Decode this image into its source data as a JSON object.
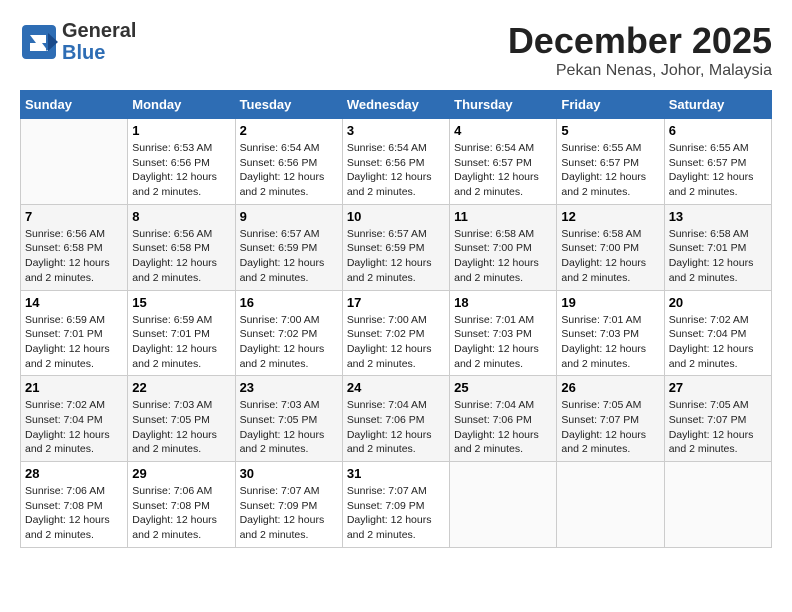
{
  "header": {
    "logo_general": "General",
    "logo_blue": "Blue",
    "month": "December 2025",
    "location": "Pekan Nenas, Johor, Malaysia"
  },
  "weekdays": [
    "Sunday",
    "Monday",
    "Tuesday",
    "Wednesday",
    "Thursday",
    "Friday",
    "Saturday"
  ],
  "weeks": [
    [
      {
        "day": "",
        "sunrise": "",
        "sunset": "",
        "daylight": ""
      },
      {
        "day": "1",
        "sunrise": "Sunrise: 6:53 AM",
        "sunset": "Sunset: 6:56 PM",
        "daylight": "Daylight: 12 hours and 2 minutes."
      },
      {
        "day": "2",
        "sunrise": "Sunrise: 6:54 AM",
        "sunset": "Sunset: 6:56 PM",
        "daylight": "Daylight: 12 hours and 2 minutes."
      },
      {
        "day": "3",
        "sunrise": "Sunrise: 6:54 AM",
        "sunset": "Sunset: 6:56 PM",
        "daylight": "Daylight: 12 hours and 2 minutes."
      },
      {
        "day": "4",
        "sunrise": "Sunrise: 6:54 AM",
        "sunset": "Sunset: 6:57 PM",
        "daylight": "Daylight: 12 hours and 2 minutes."
      },
      {
        "day": "5",
        "sunrise": "Sunrise: 6:55 AM",
        "sunset": "Sunset: 6:57 PM",
        "daylight": "Daylight: 12 hours and 2 minutes."
      },
      {
        "day": "6",
        "sunrise": "Sunrise: 6:55 AM",
        "sunset": "Sunset: 6:57 PM",
        "daylight": "Daylight: 12 hours and 2 minutes."
      }
    ],
    [
      {
        "day": "7",
        "sunrise": "Sunrise: 6:56 AM",
        "sunset": "Sunset: 6:58 PM",
        "daylight": "Daylight: 12 hours and 2 minutes."
      },
      {
        "day": "8",
        "sunrise": "Sunrise: 6:56 AM",
        "sunset": "Sunset: 6:58 PM",
        "daylight": "Daylight: 12 hours and 2 minutes."
      },
      {
        "day": "9",
        "sunrise": "Sunrise: 6:57 AM",
        "sunset": "Sunset: 6:59 PM",
        "daylight": "Daylight: 12 hours and 2 minutes."
      },
      {
        "day": "10",
        "sunrise": "Sunrise: 6:57 AM",
        "sunset": "Sunset: 6:59 PM",
        "daylight": "Daylight: 12 hours and 2 minutes."
      },
      {
        "day": "11",
        "sunrise": "Sunrise: 6:58 AM",
        "sunset": "Sunset: 7:00 PM",
        "daylight": "Daylight: 12 hours and 2 minutes."
      },
      {
        "day": "12",
        "sunrise": "Sunrise: 6:58 AM",
        "sunset": "Sunset: 7:00 PM",
        "daylight": "Daylight: 12 hours and 2 minutes."
      },
      {
        "day": "13",
        "sunrise": "Sunrise: 6:58 AM",
        "sunset": "Sunset: 7:01 PM",
        "daylight": "Daylight: 12 hours and 2 minutes."
      }
    ],
    [
      {
        "day": "14",
        "sunrise": "Sunrise: 6:59 AM",
        "sunset": "Sunset: 7:01 PM",
        "daylight": "Daylight: 12 hours and 2 minutes."
      },
      {
        "day": "15",
        "sunrise": "Sunrise: 6:59 AM",
        "sunset": "Sunset: 7:01 PM",
        "daylight": "Daylight: 12 hours and 2 minutes."
      },
      {
        "day": "16",
        "sunrise": "Sunrise: 7:00 AM",
        "sunset": "Sunset: 7:02 PM",
        "daylight": "Daylight: 12 hours and 2 minutes."
      },
      {
        "day": "17",
        "sunrise": "Sunrise: 7:00 AM",
        "sunset": "Sunset: 7:02 PM",
        "daylight": "Daylight: 12 hours and 2 minutes."
      },
      {
        "day": "18",
        "sunrise": "Sunrise: 7:01 AM",
        "sunset": "Sunset: 7:03 PM",
        "daylight": "Daylight: 12 hours and 2 minutes."
      },
      {
        "day": "19",
        "sunrise": "Sunrise: 7:01 AM",
        "sunset": "Sunset: 7:03 PM",
        "daylight": "Daylight: 12 hours and 2 minutes."
      },
      {
        "day": "20",
        "sunrise": "Sunrise: 7:02 AM",
        "sunset": "Sunset: 7:04 PM",
        "daylight": "Daylight: 12 hours and 2 minutes."
      }
    ],
    [
      {
        "day": "21",
        "sunrise": "Sunrise: 7:02 AM",
        "sunset": "Sunset: 7:04 PM",
        "daylight": "Daylight: 12 hours and 2 minutes."
      },
      {
        "day": "22",
        "sunrise": "Sunrise: 7:03 AM",
        "sunset": "Sunset: 7:05 PM",
        "daylight": "Daylight: 12 hours and 2 minutes."
      },
      {
        "day": "23",
        "sunrise": "Sunrise: 7:03 AM",
        "sunset": "Sunset: 7:05 PM",
        "daylight": "Daylight: 12 hours and 2 minutes."
      },
      {
        "day": "24",
        "sunrise": "Sunrise: 7:04 AM",
        "sunset": "Sunset: 7:06 PM",
        "daylight": "Daylight: 12 hours and 2 minutes."
      },
      {
        "day": "25",
        "sunrise": "Sunrise: 7:04 AM",
        "sunset": "Sunset: 7:06 PM",
        "daylight": "Daylight: 12 hours and 2 minutes."
      },
      {
        "day": "26",
        "sunrise": "Sunrise: 7:05 AM",
        "sunset": "Sunset: 7:07 PM",
        "daylight": "Daylight: 12 hours and 2 minutes."
      },
      {
        "day": "27",
        "sunrise": "Sunrise: 7:05 AM",
        "sunset": "Sunset: 7:07 PM",
        "daylight": "Daylight: 12 hours and 2 minutes."
      }
    ],
    [
      {
        "day": "28",
        "sunrise": "Sunrise: 7:06 AM",
        "sunset": "Sunset: 7:08 PM",
        "daylight": "Daylight: 12 hours and 2 minutes."
      },
      {
        "day": "29",
        "sunrise": "Sunrise: 7:06 AM",
        "sunset": "Sunset: 7:08 PM",
        "daylight": "Daylight: 12 hours and 2 minutes."
      },
      {
        "day": "30",
        "sunrise": "Sunrise: 7:07 AM",
        "sunset": "Sunset: 7:09 PM",
        "daylight": "Daylight: 12 hours and 2 minutes."
      },
      {
        "day": "31",
        "sunrise": "Sunrise: 7:07 AM",
        "sunset": "Sunset: 7:09 PM",
        "daylight": "Daylight: 12 hours and 2 minutes."
      },
      {
        "day": "",
        "sunrise": "",
        "sunset": "",
        "daylight": ""
      },
      {
        "day": "",
        "sunrise": "",
        "sunset": "",
        "daylight": ""
      },
      {
        "day": "",
        "sunrise": "",
        "sunset": "",
        "daylight": ""
      }
    ]
  ]
}
